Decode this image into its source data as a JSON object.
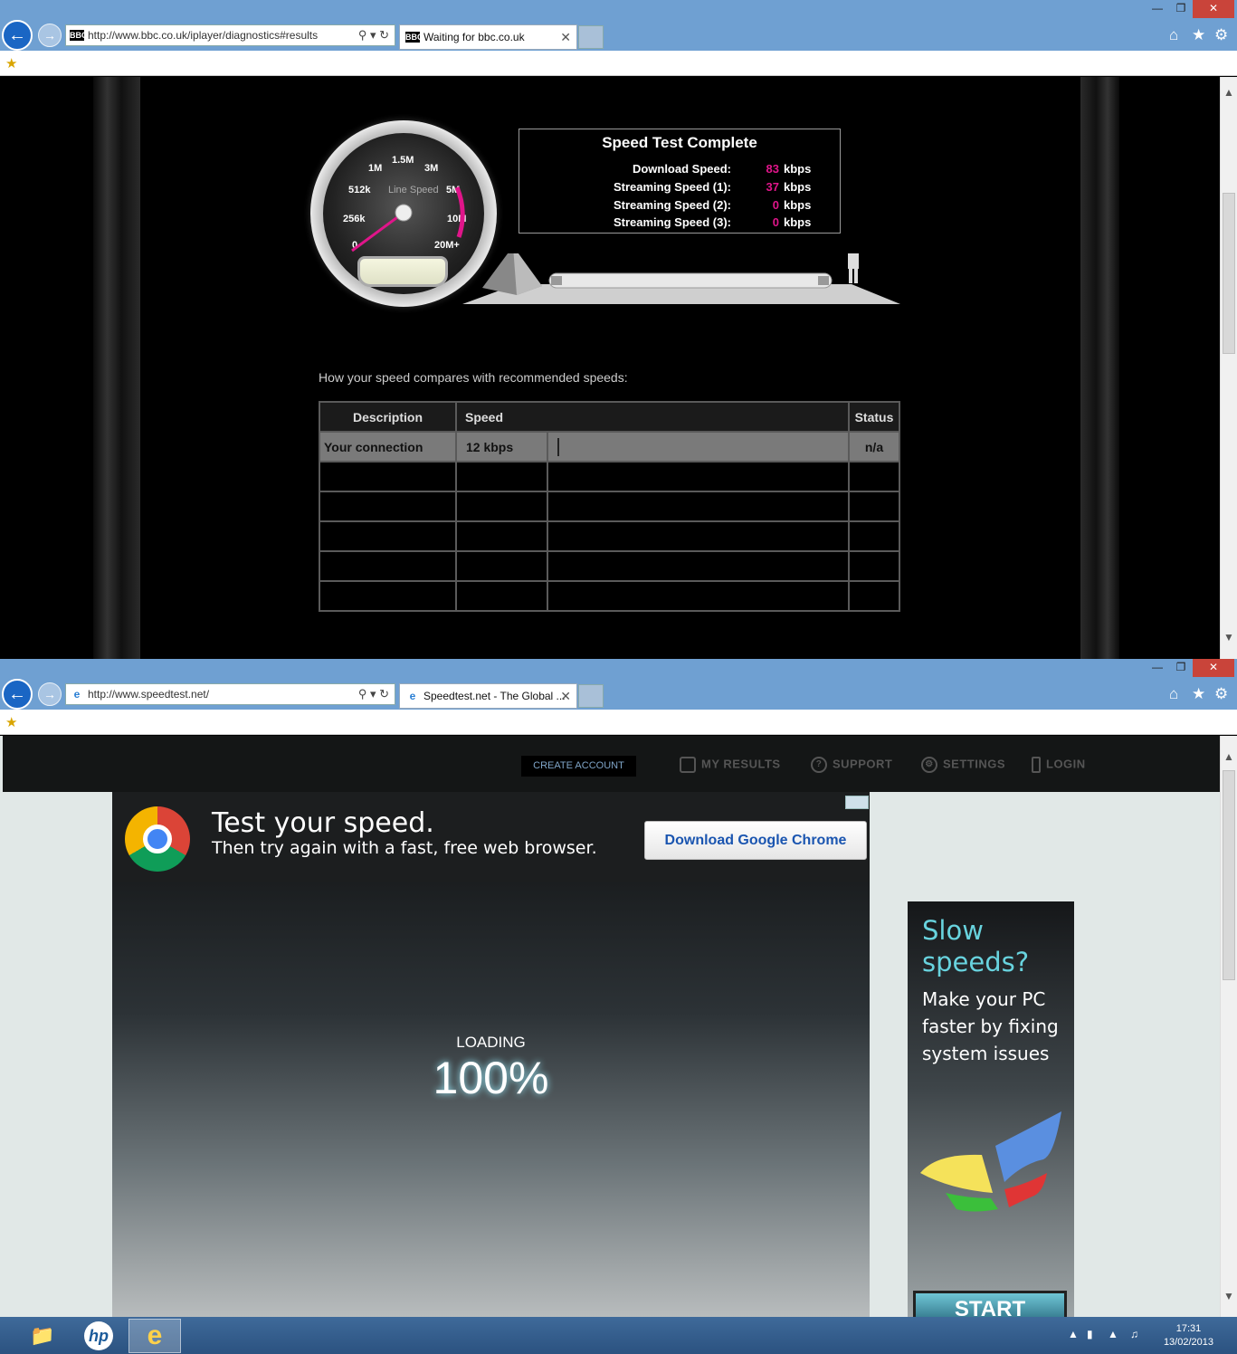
{
  "window1": {
    "address": "http://www.bbc.co.uk/iplayer/diagnostics#results",
    "tab_title": "Waiting for bbc.co.uk",
    "favicon_text": "BBC"
  },
  "gauge": {
    "labels": [
      "1.5M",
      "1M",
      "3M",
      "512k",
      "5M",
      "256k",
      "10M",
      "0",
      "20M+"
    ],
    "caption": "Line Speed"
  },
  "result": {
    "title": "Speed Test Complete",
    "rows": [
      {
        "label": "Download Speed:",
        "value": "83",
        "unit": "kbps"
      },
      {
        "label": "Streaming Speed (1):",
        "value": "37",
        "unit": "kbps"
      },
      {
        "label": "Streaming Speed (2):",
        "value": "0",
        "unit": "kbps"
      },
      {
        "label": "Streaming Speed (3):",
        "value": "0",
        "unit": "kbps"
      }
    ]
  },
  "compare": {
    "heading": "How your speed compares with recommended speeds:",
    "headers": {
      "description": "Description",
      "speed": "Speed",
      "status": "Status"
    },
    "rows": [
      {
        "description": "Your connection",
        "speed": "12 kbps",
        "status": "n/a"
      }
    ]
  },
  "window2": {
    "address": "http://www.speedtest.net/",
    "tab_title": "Speedtest.net - The Global ..."
  },
  "speedtest": {
    "create_account": "CREATE ACCOUNT",
    "menu": [
      "MY RESULTS",
      "SUPPORT",
      "SETTINGS",
      "LOGIN"
    ],
    "ad_title": "Test your speed.",
    "ad_sub": "Then try again with a fast, free web browser.",
    "ad_button": "Download Google Chrome",
    "loading_label": "LOADING",
    "loading_pct": "100%",
    "side_ad_title": "Slow speeds?",
    "side_ad_body": "Make your PC faster by fixing system issues",
    "side_ad_button": "START"
  },
  "taskbar": {
    "time": "17:31",
    "date": "13/02/2013"
  },
  "colors": {
    "accent_magenta": "#e0158a",
    "titlebar": "#6fa0d2",
    "close_red": "#c9443a"
  }
}
